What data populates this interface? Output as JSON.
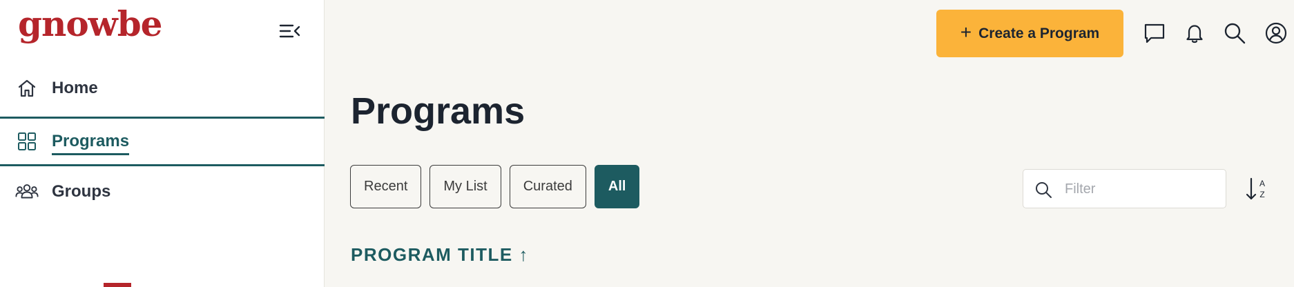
{
  "app": {
    "logo_text": "gnowbe",
    "brand_color": "#b5252b",
    "accent_color": "#1d5b60",
    "cta_color": "#fbb33a"
  },
  "sidebar": {
    "items": [
      {
        "label": "Home",
        "icon": "home-icon",
        "active": false
      },
      {
        "label": "Programs",
        "icon": "grid-icon",
        "active": true
      },
      {
        "label": "Groups",
        "icon": "users-icon",
        "active": false
      }
    ]
  },
  "topbar": {
    "create_label": "Create a Program",
    "icons": [
      "chat-icon",
      "bell-icon",
      "search-icon",
      "user-icon"
    ]
  },
  "main": {
    "title": "Programs",
    "tabs": [
      {
        "label": "Recent",
        "active": false
      },
      {
        "label": "My List",
        "active": false
      },
      {
        "label": "Curated",
        "active": false
      },
      {
        "label": "All",
        "active": true
      }
    ],
    "filter": {
      "placeholder": "Filter",
      "value": ""
    },
    "sort_icon": "sort-az-icon",
    "column_header": "PROGRAM TITLE ↑"
  }
}
